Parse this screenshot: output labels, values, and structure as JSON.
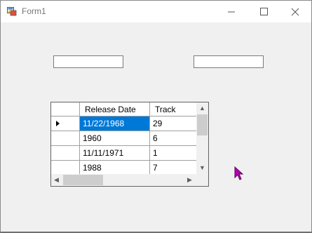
{
  "window": {
    "title": "Form1"
  },
  "grid": {
    "columns": [
      "Release Date",
      "Track"
    ],
    "rows": [
      {
        "release_date": "11/22/1968",
        "track": "29",
        "selected": true
      },
      {
        "release_date": "1960",
        "track": "6"
      },
      {
        "release_date": "11/11/1971",
        "track": "1"
      },
      {
        "release_date": "1988",
        "track": "7"
      }
    ]
  },
  "textboxes": {
    "first_value": "",
    "second_value": ""
  },
  "colors": {
    "selection": "#0078d7",
    "cursor": "#b000b0"
  }
}
